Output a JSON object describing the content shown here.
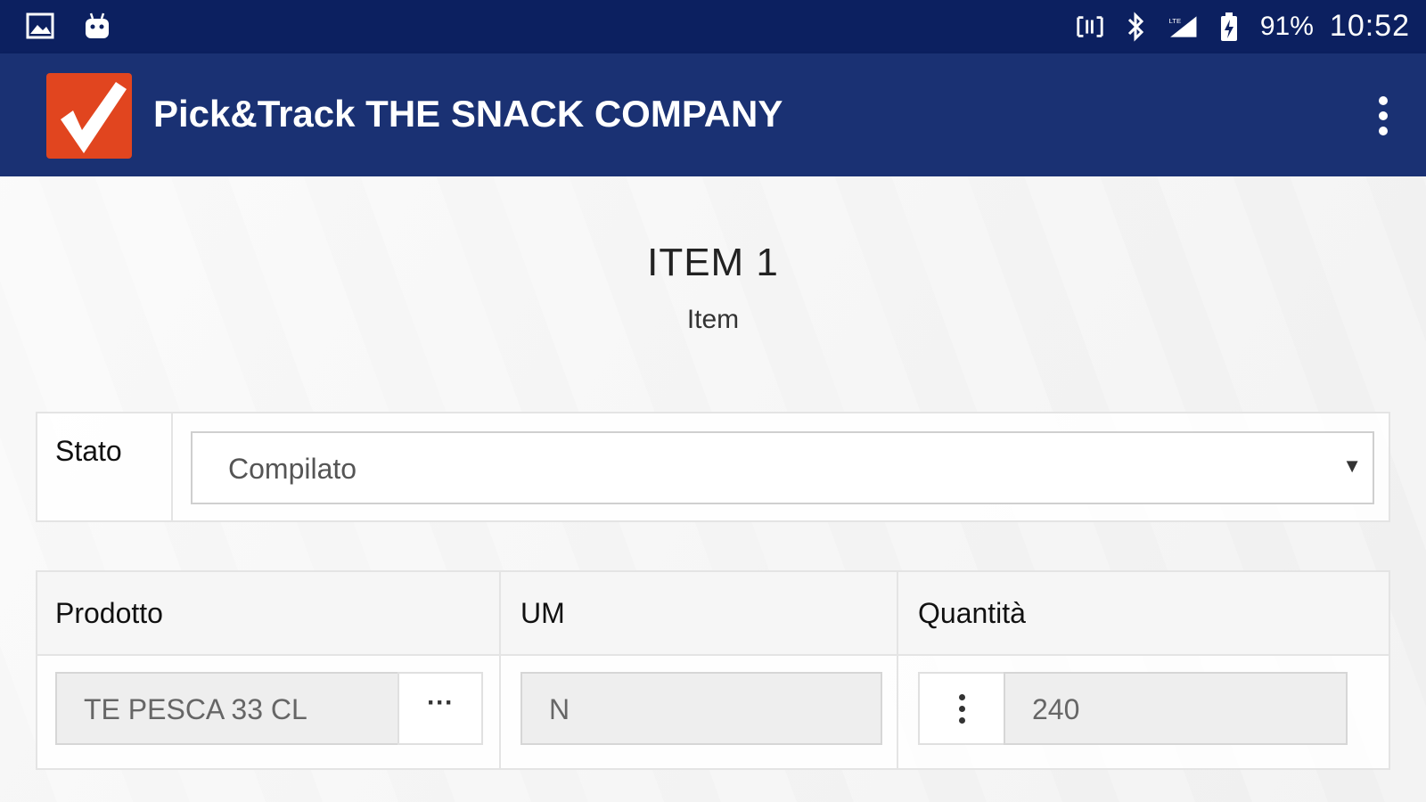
{
  "status_bar": {
    "battery": "91%",
    "time": "10:52",
    "icons": [
      "image-icon",
      "android-icon",
      "nfc-icon",
      "bluetooth-icon",
      "signal-icon",
      "battery-icon"
    ]
  },
  "app_bar": {
    "title": "Pick&Track THE SNACK COMPANY",
    "logo": "checkmark-logo",
    "menu_icon": "overflow-menu-icon",
    "accent_color": "#1a3173",
    "logo_color": "#e1451f"
  },
  "item": {
    "title": "ITEM 1",
    "subtitle": "Item"
  },
  "stato": {
    "label": "Stato",
    "selected": "Compilato"
  },
  "table": {
    "headers": [
      "Prodotto",
      "UM",
      "Quantità"
    ],
    "row": {
      "prodotto": "TE PESCA 33 CL",
      "prodotto_button": "···",
      "um": "N",
      "quantita": "240"
    }
  }
}
